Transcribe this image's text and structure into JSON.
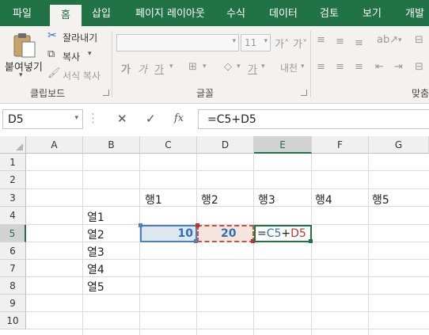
{
  "tabs": [
    {
      "label": "파일",
      "active": false
    },
    {
      "label": "홈",
      "active": true
    },
    {
      "label": "삽입",
      "active": false
    },
    {
      "label": "페이지 레이아웃",
      "active": false
    },
    {
      "label": "수식",
      "active": false
    },
    {
      "label": "데이터",
      "active": false
    },
    {
      "label": "검토",
      "active": false
    },
    {
      "label": "보기",
      "active": false
    },
    {
      "label": "개발",
      "active": false
    }
  ],
  "ribbon": {
    "clipboard": {
      "paste_label": "붙여넣기",
      "cut_label": "잘라내기",
      "copy_label": "복사",
      "format_painter_label": "서식 복사",
      "group_label": "클립보드"
    },
    "font": {
      "font_size": "11",
      "group_label": "글꼴"
    },
    "alignment": {
      "group_label": "맞춤"
    }
  },
  "formula_bar": {
    "name_box": "D5",
    "fx_label": "fx",
    "formula": "=C5+D5"
  },
  "sheet": {
    "columns": [
      "A",
      "B",
      "C",
      "D",
      "E",
      "F",
      "G"
    ],
    "rows": [
      "1",
      "2",
      "3",
      "4",
      "5",
      "6",
      "7",
      "8",
      "9",
      "10"
    ],
    "selected_column": "E",
    "selected_row": "5",
    "cells": {
      "C3": "행1",
      "D3": "행2",
      "E3": "행3",
      "F3": "행4",
      "G3": "행5",
      "B4": "열1",
      "B5": "열2",
      "B6": "열3",
      "B7": "열4",
      "B8": "열5",
      "C5": "10",
      "D5": "20"
    },
    "edit_cell": {
      "eq": "=",
      "ref1": "C5",
      "plus": "+",
      "ref2": "D5"
    }
  },
  "colors": {
    "accent": "#217346",
    "ref1": "#2f6fb2",
    "ref2": "#c0322b"
  }
}
